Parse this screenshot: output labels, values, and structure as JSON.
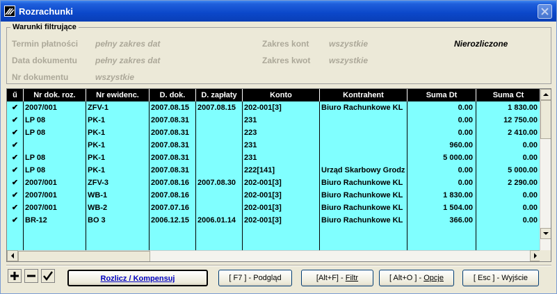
{
  "window": {
    "title": "Rozrachunki"
  },
  "filter": {
    "legend": "Warunki filtrujące",
    "termin_label": "Termin płatności",
    "termin_value": "pełny zakres dat",
    "data_label": "Data dokumentu",
    "data_value": "pełny zakres dat",
    "nr_label": "Nr dokumentu",
    "nr_value": "wszystkie",
    "konta_label": "Zakres kont",
    "konta_value": "wszystkie",
    "kwot_label": "Zakres kwot",
    "kwot_value": "wszystkie",
    "status": "Nierozliczone"
  },
  "table": {
    "columns": [
      "ű",
      "Nr dok. roz.",
      "Nr ewidenc.",
      "D. dok.",
      "D. zapłaty",
      "Konto",
      "Kontrahent",
      "Suma Dt",
      "Suma Ct"
    ],
    "rows": [
      [
        "✔",
        "2007/001",
        "ZFV-1",
        "2007.08.15",
        "2007.08.15",
        "202-001[3]",
        "Biuro Rachunkowe KL",
        "0.00",
        "1 830.00"
      ],
      [
        "✔",
        "LP 08",
        "PK-1",
        "2007.08.31",
        "",
        "231",
        "",
        "0.00",
        "12 750.00"
      ],
      [
        "✔",
        "LP 08",
        "PK-1",
        "2007.08.31",
        "",
        "223",
        "",
        "0.00",
        "2 410.00"
      ],
      [
        "✔",
        "",
        "PK-1",
        "2007.08.31",
        "",
        "231",
        "",
        "960.00",
        "0.00"
      ],
      [
        "✔",
        "LP 08",
        "PK-1",
        "2007.08.31",
        "",
        "231",
        "",
        "5 000.00",
        "0.00"
      ],
      [
        "✔",
        "LP 08",
        "PK-1",
        "2007.08.31",
        "",
        "222[141]",
        "Urząd Skarbowy Grodz",
        "0.00",
        "5 000.00"
      ],
      [
        "✔",
        "2007/001",
        "ZFV-3",
        "2007.08.16",
        "2007.08.30",
        "202-001[3]",
        "Biuro Rachunkowe KL",
        "0.00",
        "2 290.00"
      ],
      [
        "✔",
        "2007/001",
        "WB-1",
        "2007.08.16",
        "",
        "202-001[3]",
        "Biuro Rachunkowe KL",
        "1 830.00",
        "0.00"
      ],
      [
        "✔",
        "2007/001",
        "WB-2",
        "2007.07.16",
        "",
        "202-001[3]",
        "Biuro Rachunkowe KL",
        "1 504.00",
        "0.00"
      ],
      [
        "✔",
        "BR-12",
        "BO 3",
        "2006.12.15",
        "2006.01.14",
        "202-001[3]",
        "Biuro Rachunkowe KL",
        "366.00",
        "0.00"
      ]
    ]
  },
  "toolbar": {
    "add_icon": "plus-icon",
    "remove_icon": "minus-icon",
    "confirm_icon": "check-icon"
  },
  "buttons": {
    "rozlicz": "Rozlicz / Kompensuj",
    "podglad": "[ F7 ] - Podgląd",
    "filtr_prefix": "[Alt+F] - ",
    "filtr_label": "Filtr",
    "opcje_prefix": "[ Alt+O ] - ",
    "opcje_label": "Opcje",
    "wyjscie": "[ Esc ] - Wyjście"
  },
  "colors": {
    "grid_bg": "#80ffff",
    "header_bg": "#000000",
    "title_bar": "#0b47c9"
  }
}
